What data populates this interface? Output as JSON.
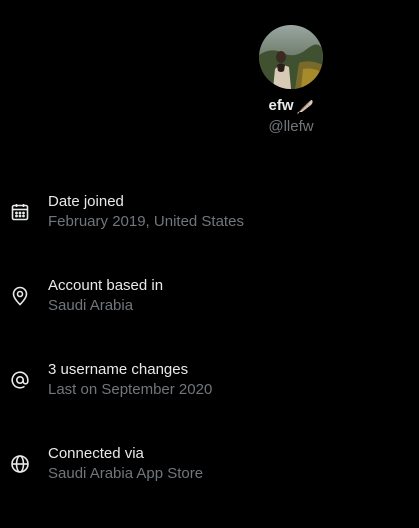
{
  "profile": {
    "display_name": "efw",
    "handle": "@llefw",
    "badge_icon": "feather-icon"
  },
  "details": [
    {
      "icon": "calendar-icon",
      "title": "Date joined",
      "subtitle": "February 2019, United States"
    },
    {
      "icon": "location-pin-icon",
      "title": "Account based in",
      "subtitle": "Saudi Arabia"
    },
    {
      "icon": "at-sign-icon",
      "title": "3 username changes",
      "subtitle": "Last on September 2020"
    },
    {
      "icon": "globe-icon",
      "title": "Connected via",
      "subtitle": "Saudi Arabia App Store"
    }
  ],
  "colors": {
    "background": "#000000",
    "primary_text": "#e7e9ea",
    "secondary_text": "#71767b"
  }
}
